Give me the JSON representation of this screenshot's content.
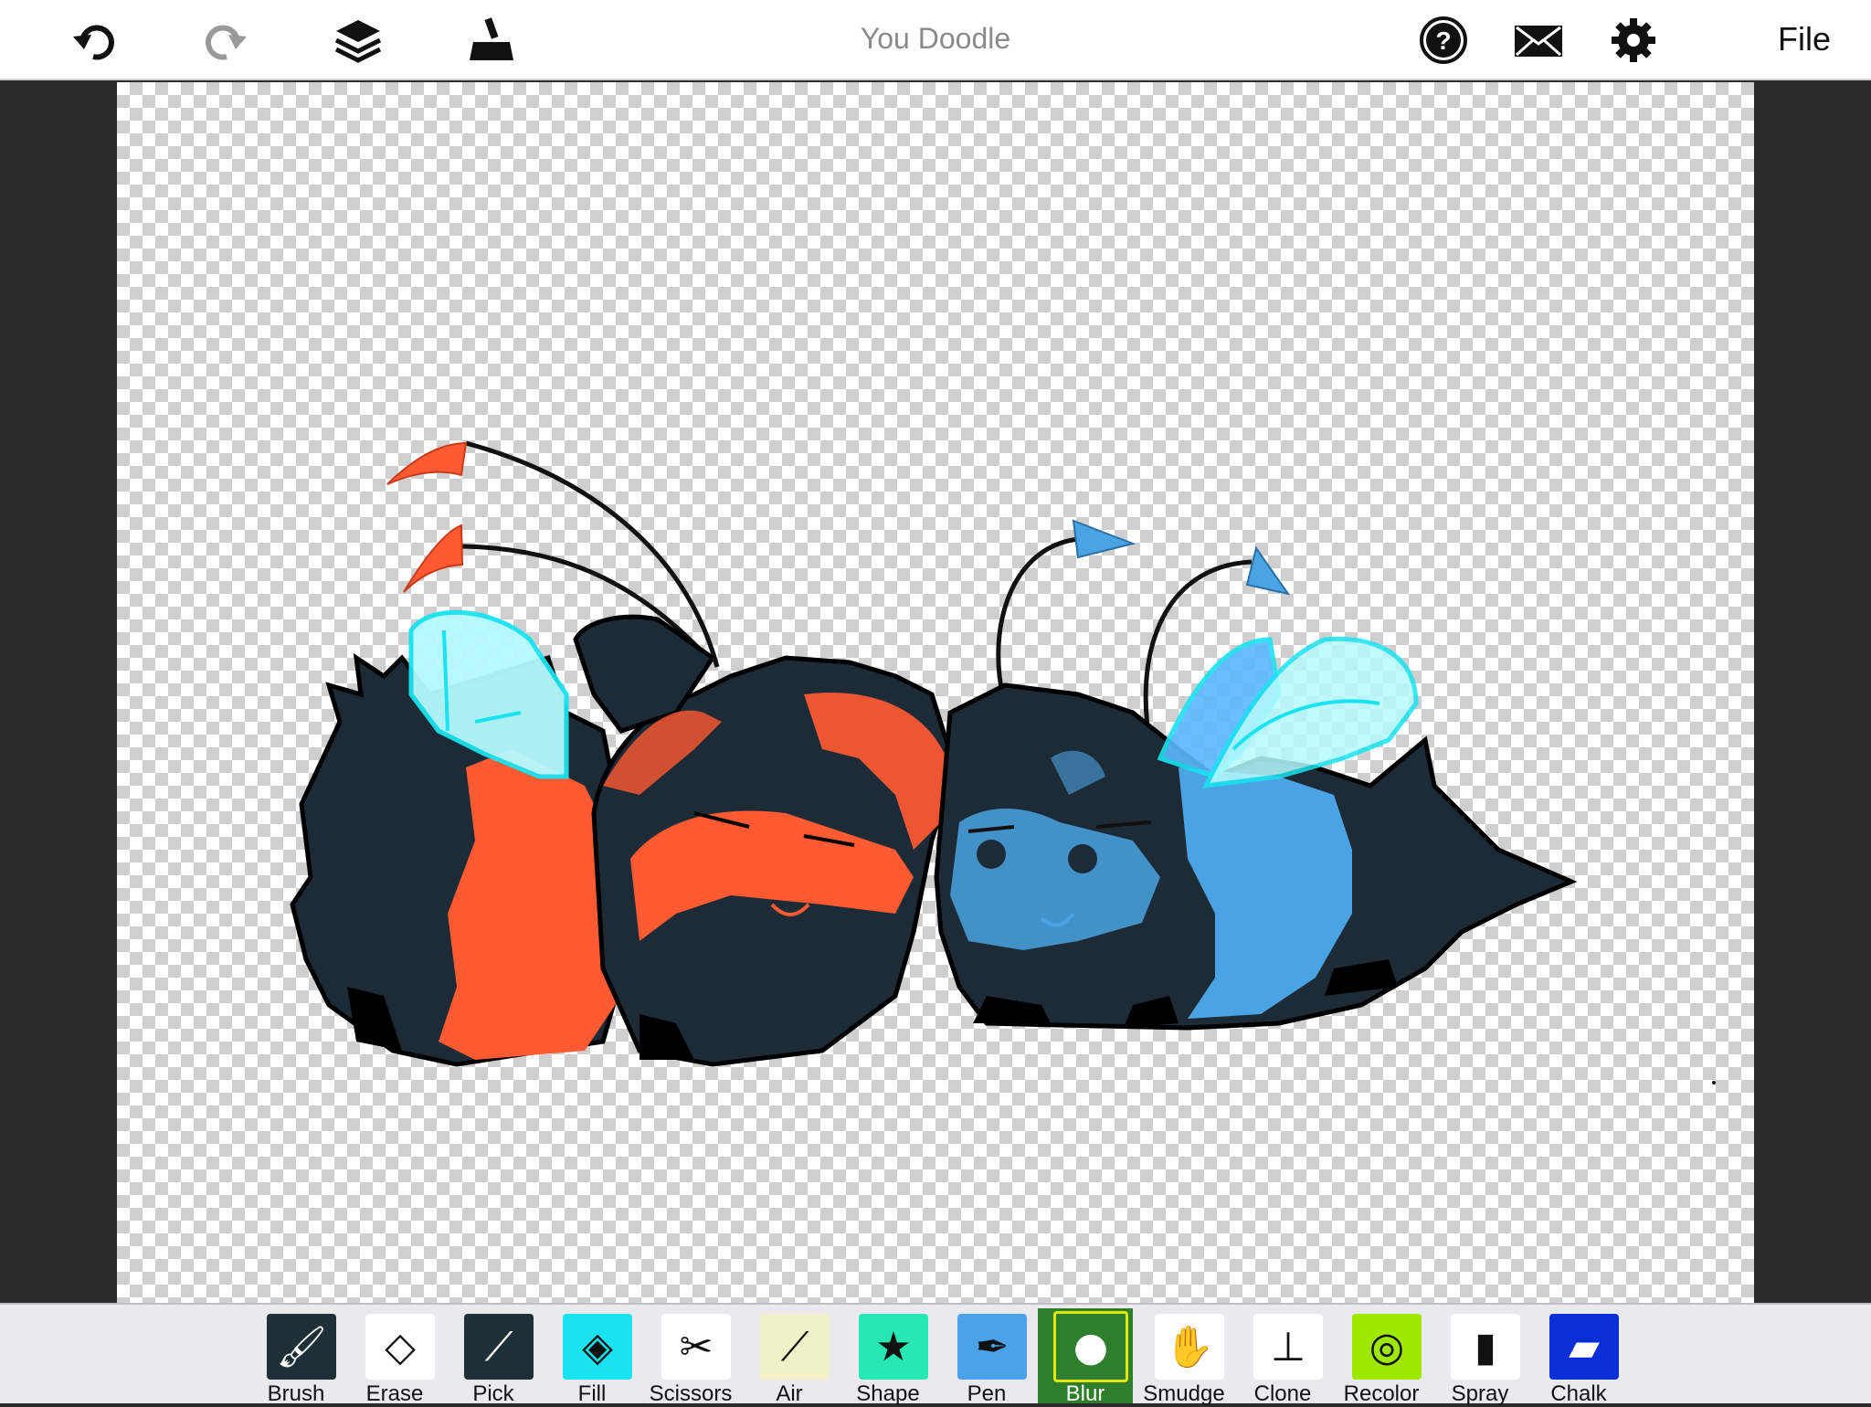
{
  "app": {
    "title": "You Doodle"
  },
  "topbar": {
    "file_label": "File",
    "left_icons": [
      "undo-icon",
      "redo-icon",
      "layers-icon",
      "stamp-icon"
    ],
    "right_icons": [
      "help-icon",
      "mail-icon",
      "settings-icon"
    ]
  },
  "tools": [
    {
      "label": "Brush",
      "icon": "brush-icon",
      "color": "#1f2f38"
    },
    {
      "label": "Erase",
      "icon": "eraser-icon",
      "color": "#ffffff"
    },
    {
      "label": "Pick",
      "icon": "eyedropper-icon",
      "color": "#1f2f38"
    },
    {
      "label": "Fill",
      "icon": "fill-bucket-icon",
      "color": "#19e3f0"
    },
    {
      "label": "Scissors",
      "icon": "scissors-icon",
      "color": "#ffffff"
    },
    {
      "label": "Air",
      "icon": "airbrush-icon",
      "color": "#f2f0c6"
    },
    {
      "label": "Shape",
      "icon": "shape-icon",
      "color": "#27e8b3"
    },
    {
      "label": "Pen",
      "icon": "pen-icon",
      "color": "#4aa3e8"
    },
    {
      "label": "Blur",
      "icon": "blur-drop-icon",
      "color": "#2e7f2b"
    },
    {
      "label": "Smudge",
      "icon": "smudge-hand-icon",
      "color": "#ffffff"
    },
    {
      "label": "Clone",
      "icon": "clone-stamp-icon",
      "color": "#ffffff"
    },
    {
      "label": "Recolor",
      "icon": "recolor-icon",
      "color": "#9ee800"
    },
    {
      "label": "Spray",
      "icon": "spray-can-icon",
      "color": "#ffffff"
    },
    {
      "label": "Chalk",
      "icon": "chalk-icon",
      "color": "#0a2fd6"
    }
  ],
  "selected_tool": "Blur",
  "colors": {
    "red_bee": "#ff5a32",
    "blue_bee": "#4aa3e3",
    "fur": "#1d2b36",
    "wing": "#b5fbff",
    "wing_outline": "#19e3f0"
  }
}
